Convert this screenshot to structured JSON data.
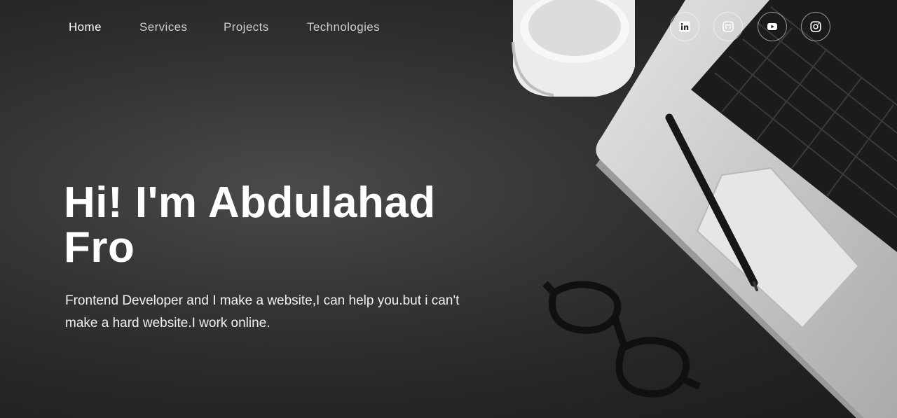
{
  "nav": {
    "links": [
      {
        "label": "Home",
        "active": true
      },
      {
        "label": "Services",
        "active": false
      },
      {
        "label": "Projects",
        "active": false
      },
      {
        "label": "Technologies",
        "active": false
      }
    ]
  },
  "social": [
    {
      "name": "linkedin",
      "icon": "linkedin-icon"
    },
    {
      "name": "github",
      "icon": "github-icon"
    },
    {
      "name": "youtube",
      "icon": "youtube-icon"
    },
    {
      "name": "instagram",
      "icon": "instagram-icon"
    }
  ],
  "hero": {
    "title_line1": "Hi! I'm Abdulahad",
    "title_line2": "Fro",
    "description": "Frontend Developer and I make a website,I can help you.but i can't make a hard website.I work online."
  },
  "colors": {
    "background": "#2e2e2e",
    "text": "#ffffff",
    "nav_inactive": "#cfcfcf"
  }
}
